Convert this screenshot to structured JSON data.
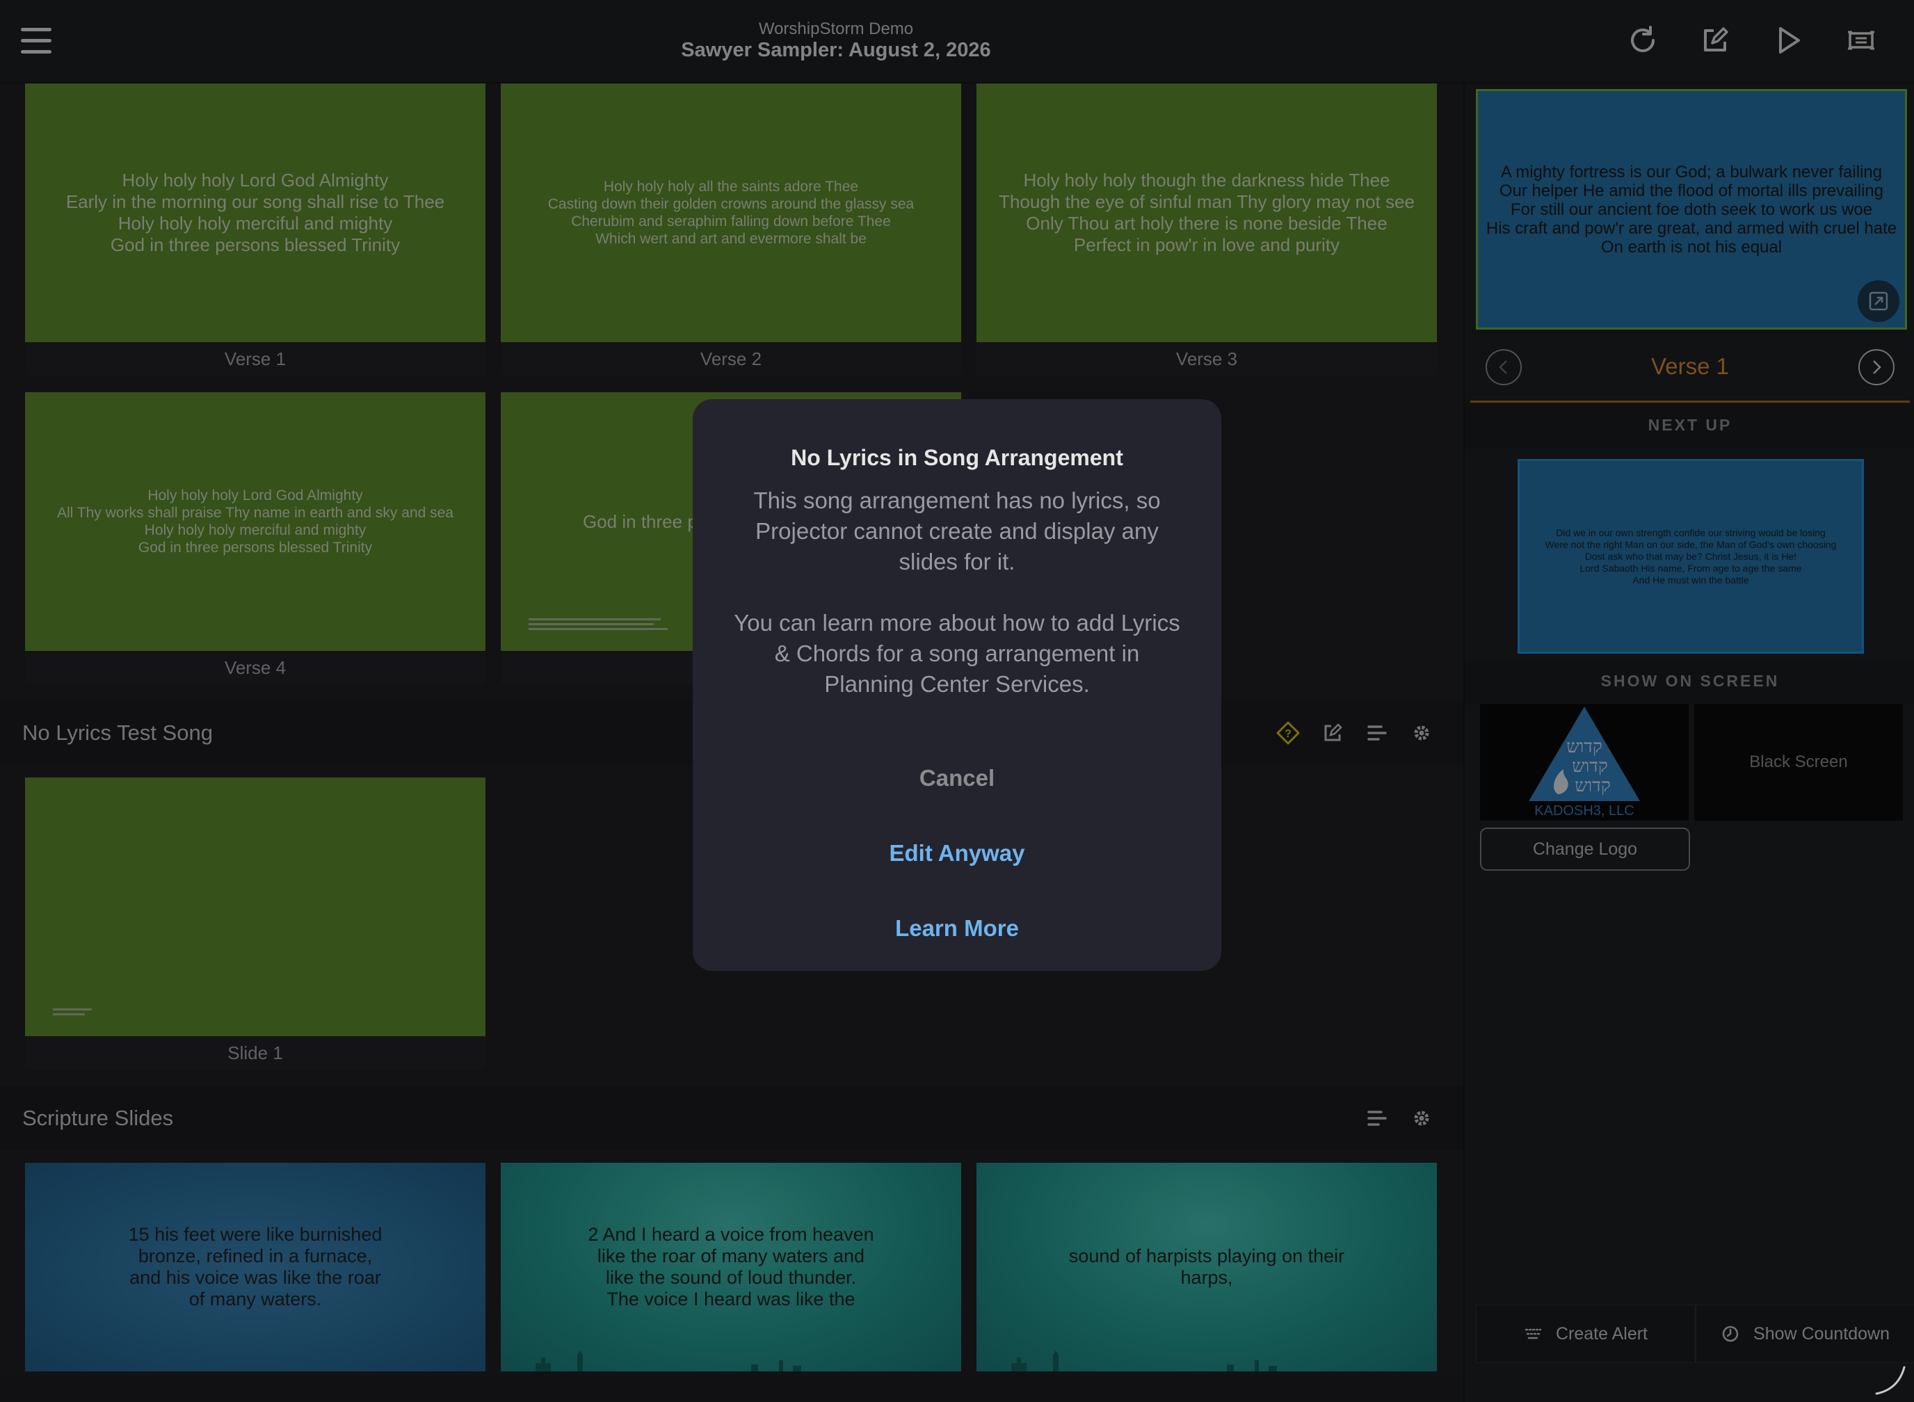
{
  "header": {
    "app_name": "WorshipStorm Demo",
    "plan_title": "Sawyer Sampler: August 2, 2026"
  },
  "songs": [
    {
      "slides": [
        {
          "label": "Verse 1",
          "lyrics": "Holy holy holy Lord God Almighty\nEarly in the morning our song shall rise to Thee\nHoly holy holy merciful and mighty\nGod in three persons blessed Trinity"
        },
        {
          "label": "Verse 2",
          "lyrics": "Holy holy holy all the saints adore Thee\nCasting down their golden crowns around the glassy sea\nCherubim and seraphim falling down before Thee\nWhich wert and art and evermore shalt be"
        },
        {
          "label": "Verse 3",
          "lyrics": "Holy holy holy though the darkness hide Thee\nThough the eye of sinful man Thy glory may not see\nOnly Thou art holy there is none beside Thee\nPerfect in pow'r in love and purity"
        },
        {
          "label": "Verse 4",
          "lyrics": "Holy holy holy Lord God Almighty\nAll Thy works shall praise Thy name in earth and sky and sea\nHoly holy holy merciful and mighty\nGod in three persons blessed Trinity"
        },
        {
          "label": "",
          "lyrics": "God in three p"
        }
      ]
    }
  ],
  "no_lyrics_section": {
    "title": "No Lyrics Test Song",
    "slides": [
      {
        "label": "Slide 1"
      }
    ]
  },
  "scripture_section": {
    "title": "Scripture Slides",
    "slides": [
      {
        "text": "15 his feet were like burnished\nbronze, refined in a furnace,\nand his voice was like the roar\nof many waters."
      },
      {
        "text": "2 And I heard a voice from heaven\nlike the roar of many waters and\nlike the sound of loud thunder.\nThe voice I heard was like the"
      },
      {
        "text": "sound of harpists playing on their\nharps,"
      }
    ]
  },
  "right_panel": {
    "live_lyrics": "A mighty fortress is our God; a bulwark never failing\nOur helper He amid the flood of mortal ills prevailing\nFor still our ancient foe doth seek to work us woe\nHis craft and pow'r are great, and armed with cruel hate\nOn earth is not his equal",
    "current_label": "Verse 1",
    "next_up_label": "NEXT UP",
    "next_lyrics": "Did we in our own strength confide our striving would be losing\nWere not the right Man on our side, the Man of God's own choosing\nDost ask who that may be? Christ Jesus, it is He!\nLord Sabaoth His name, From age to age the same\nAnd He must win the battle",
    "show_on_screen_label": "SHOW ON SCREEN",
    "logo_text": "KADOSH3, LLC",
    "black_screen_label": "Black Screen",
    "change_logo_label": "Change Logo",
    "create_alert_label": "Create Alert",
    "show_countdown_label": "Show Countdown"
  },
  "modal": {
    "title": "No Lyrics in Song Arrangement",
    "body": "This song arrangement has no lyrics, so Projector cannot create and display any slides for it.\n\nYou can learn more about how to add Lyrics & Chords for a song arrangement in Planning Center Services.",
    "cancel_label": "Cancel",
    "edit_label": "Edit Anyway",
    "learn_label": "Learn More"
  },
  "colors": {
    "slide_green": "#5a8a26",
    "accent_orange": "#d98b2b",
    "link_blue": "#6fb3ee",
    "live_border": "#6dae38"
  }
}
